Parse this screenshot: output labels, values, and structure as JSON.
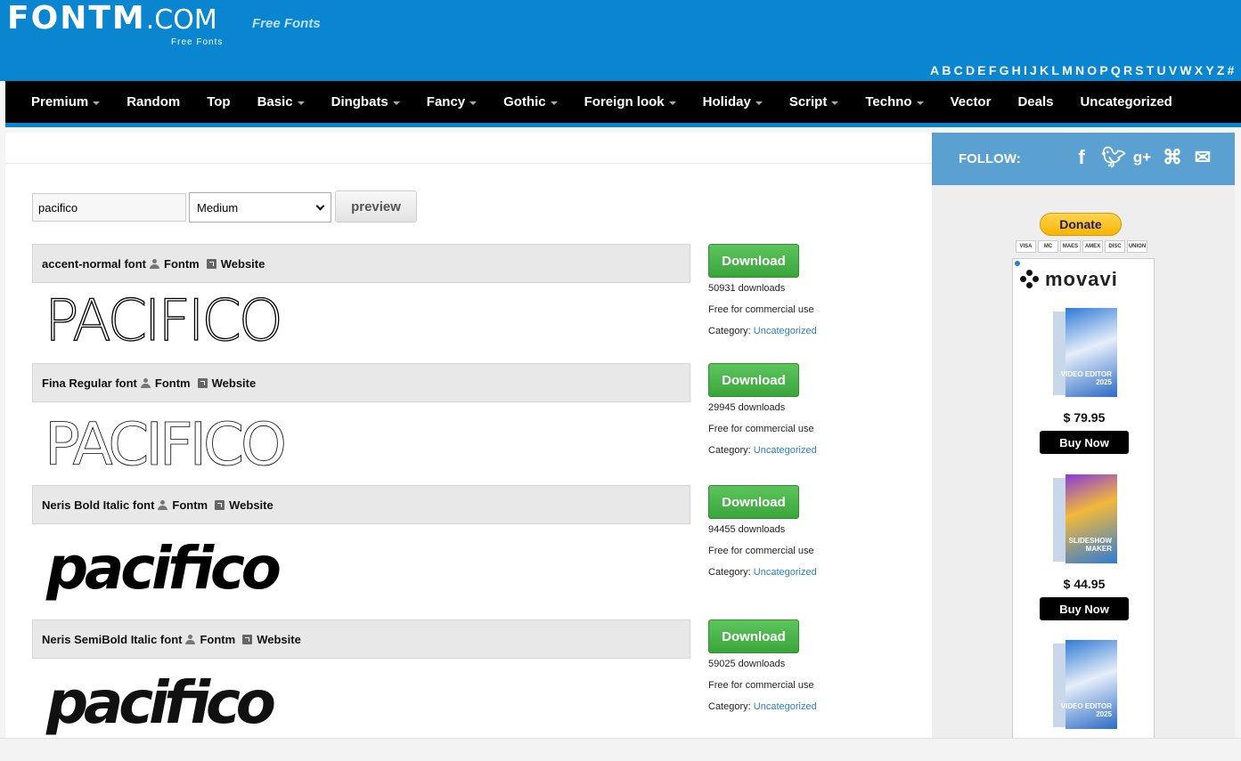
{
  "header": {
    "logo_main": "FONTM",
    "logo_tld": ".COM",
    "logo_sub": "Free Fonts",
    "tagline": "Free Fonts",
    "alphabet": [
      "A",
      "B",
      "C",
      "D",
      "E",
      "F",
      "G",
      "H",
      "I",
      "J",
      "K",
      "L",
      "M",
      "N",
      "O",
      "P",
      "Q",
      "R",
      "S",
      "T",
      "U",
      "V",
      "W",
      "X",
      "Y",
      "Z",
      "#"
    ]
  },
  "nav": {
    "items": [
      {
        "label": "Premium",
        "has_caret": true
      },
      {
        "label": "Random",
        "has_caret": false
      },
      {
        "label": "Top",
        "has_caret": false
      },
      {
        "label": "Basic",
        "has_caret": true
      },
      {
        "label": "Dingbats",
        "has_caret": true
      },
      {
        "label": "Fancy",
        "has_caret": true
      },
      {
        "label": "Gothic",
        "has_caret": true
      },
      {
        "label": "Foreign look",
        "has_caret": true
      },
      {
        "label": "Holiday",
        "has_caret": true
      },
      {
        "label": "Script",
        "has_caret": true
      },
      {
        "label": "Techno",
        "has_caret": true
      },
      {
        "label": "Vector",
        "has_caret": false
      },
      {
        "label": "Deals",
        "has_caret": false
      },
      {
        "label": "Uncategorized",
        "has_caret": false
      }
    ]
  },
  "search": {
    "text_value": "pacifico",
    "weight_selected": "Medium",
    "preview_label": "preview"
  },
  "fonts": [
    {
      "name": "accent-normal font",
      "author": "Fontm",
      "website": "Website",
      "download_label": "Download",
      "downloads": "50931 downloads",
      "license": "Free for commercial use",
      "category_label": "Category:",
      "category": "Uncategorized",
      "preview_text": "PACIFICO"
    },
    {
      "name": "Fina Regular font",
      "author": "Fontm",
      "website": "Website",
      "download_label": "Download",
      "downloads": "29945 downloads",
      "license": "Free for commercial use",
      "category_label": "Category:",
      "category": "Uncategorized",
      "preview_text": "PACIFICO"
    },
    {
      "name": "Neris Bold Italic font",
      "author": "Fontm",
      "website": "Website",
      "download_label": "Download",
      "downloads": "94455 downloads",
      "license": "Free for commercial use",
      "category_label": "Category:",
      "category": "Uncategorized",
      "preview_text": "pacifico"
    },
    {
      "name": "Neris SemiBold Italic font",
      "author": "Fontm",
      "website": "Website",
      "download_label": "Download",
      "downloads": "59025 downloads",
      "license": "Free for commercial use",
      "category_label": "Category:",
      "category": "Uncategorized",
      "preview_text": "pacifico"
    }
  ],
  "sidebar": {
    "follow_label": "FOLLOW:",
    "social_icons": [
      "facebook-icon",
      "twitter-icon",
      "google-plus-icon",
      "rss-icon",
      "email-icon"
    ],
    "donate_label": "Donate",
    "card_icons": [
      "VISA",
      "MC",
      "MAES",
      "AMEX",
      "DISC",
      "UNION"
    ],
    "ad": {
      "brand": "movavi",
      "products": [
        {
          "box_label": "VIDEO EDITOR 2025",
          "price": "$ 79.95",
          "buy_label": "Buy Now"
        },
        {
          "box_label": "SLIDESHOW MAKER",
          "price": "$ 44.95",
          "buy_label": "Buy Now"
        },
        {
          "box_label": "VIDEO EDITOR 2025"
        }
      ]
    }
  },
  "colors": {
    "brand_blue": "#0a86d1",
    "follow_blue": "#5aa1d2",
    "download_green": "#3aa63a",
    "link_blue": "#2a7fc1"
  }
}
